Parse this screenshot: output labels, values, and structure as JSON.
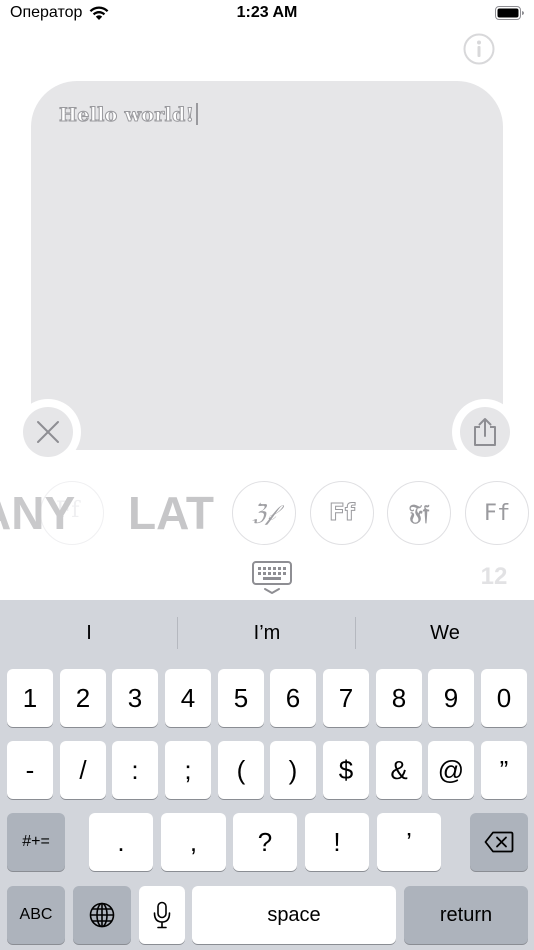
{
  "status_bar": {
    "carrier": "Оператор",
    "time": "1:23 AM"
  },
  "editor": {
    "text": "Hello world!"
  },
  "categories": {
    "any": "ANY",
    "lat": "LAT"
  },
  "styles": [
    {
      "glyph": "ℨ𝒻"
    },
    {
      "glyph": "Ff"
    },
    {
      "glyph": "𝔉𝔣"
    },
    {
      "glyph": "Ff"
    }
  ],
  "partial_style": {
    "glyph": "Ff"
  },
  "font_size": "12",
  "keyboard": {
    "suggestions": [
      "I",
      "I’m",
      "We"
    ],
    "row1": [
      "1",
      "2",
      "3",
      "4",
      "5",
      "6",
      "7",
      "8",
      "9",
      "0"
    ],
    "row2": [
      "-",
      "/",
      ":",
      ";",
      "(",
      ")",
      "$",
      "&",
      "@",
      "”"
    ],
    "row3": {
      "symbols": "#+=",
      "keys": [
        ".",
        ",",
        "?",
        "!",
        "’"
      ]
    },
    "row4": {
      "abc": "ABC",
      "space": "space",
      "return": "return"
    }
  },
  "icons": {
    "info": "info-icon",
    "clear": "close-icon",
    "share": "share-icon",
    "keyboard": "keyboard-hide-icon",
    "globe": "globe-icon",
    "mic": "microphone-icon",
    "delete": "delete-icon",
    "wifi": "wifi-icon",
    "battery": "battery-icon"
  },
  "colors": {
    "card": "#e6e6e8",
    "keyboard_bg": "#d2d5db",
    "dark_key": "#adb3bc",
    "muted": "#c6c6c8"
  }
}
